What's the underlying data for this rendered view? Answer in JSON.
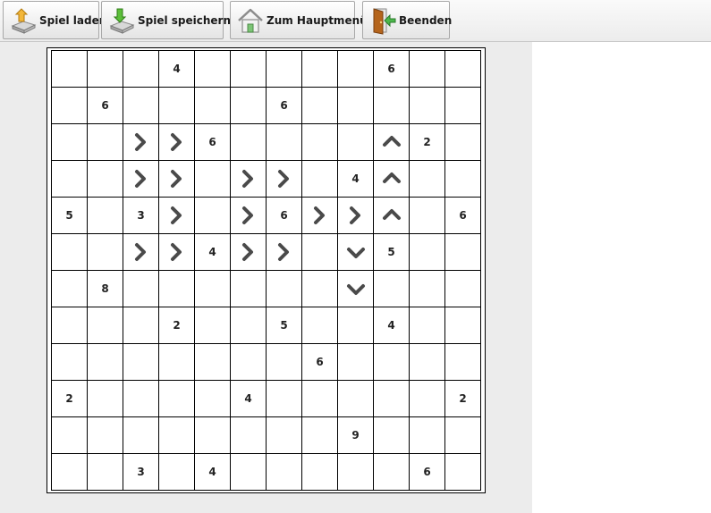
{
  "toolbar": {
    "load_label": "Spiel laden",
    "save_label": "Spiel speichern",
    "menu_label": "Zum Hauptmenü",
    "quit_label": "Beenden"
  },
  "board": {
    "rows": 12,
    "cols": 12,
    "cells": [
      [
        "",
        "",
        "",
        "4",
        "",
        "",
        "",
        "",
        "",
        "6",
        "",
        ""
      ],
      [
        "",
        "6",
        "",
        "",
        "",
        "",
        "6",
        "",
        "",
        "",
        "",
        ""
      ],
      [
        "",
        "",
        ">",
        ">",
        "6",
        "",
        "",
        "",
        "",
        "^",
        "2",
        ""
      ],
      [
        "",
        "",
        ">",
        ">",
        "",
        ">",
        ">",
        "",
        "4",
        "^",
        "",
        ""
      ],
      [
        "5",
        "",
        "3",
        ">",
        "",
        ">",
        "6",
        ">",
        ">",
        "^",
        "",
        "6"
      ],
      [
        "",
        "",
        ">",
        ">",
        "4",
        ">",
        ">",
        "",
        "v",
        "5",
        "",
        ""
      ],
      [
        "",
        "8",
        "",
        "",
        "",
        "",
        "",
        "",
        "v",
        "",
        "",
        ""
      ],
      [
        "",
        "",
        "",
        "2",
        "",
        "",
        "5",
        "",
        "",
        "4",
        "",
        ""
      ],
      [
        "",
        "",
        "",
        "",
        "",
        "",
        "",
        "6",
        "",
        "",
        "",
        ""
      ],
      [
        "2",
        "",
        "",
        "",
        "",
        "4",
        "",
        "",
        "",
        "",
        "",
        "2"
      ],
      [
        "",
        "",
        "",
        "",
        "",
        "",
        "",
        "",
        "9",
        "",
        "",
        ""
      ],
      [
        "",
        "",
        "3",
        "",
        "4",
        "",
        "",
        "",
        "",
        "",
        "6",
        ""
      ]
    ],
    "arrow_icons": {
      ">": "chevron-right-icon",
      "^": "chevron-up-icon",
      "v": "chevron-down-icon"
    },
    "arrow_color": "#4a4a4a"
  }
}
